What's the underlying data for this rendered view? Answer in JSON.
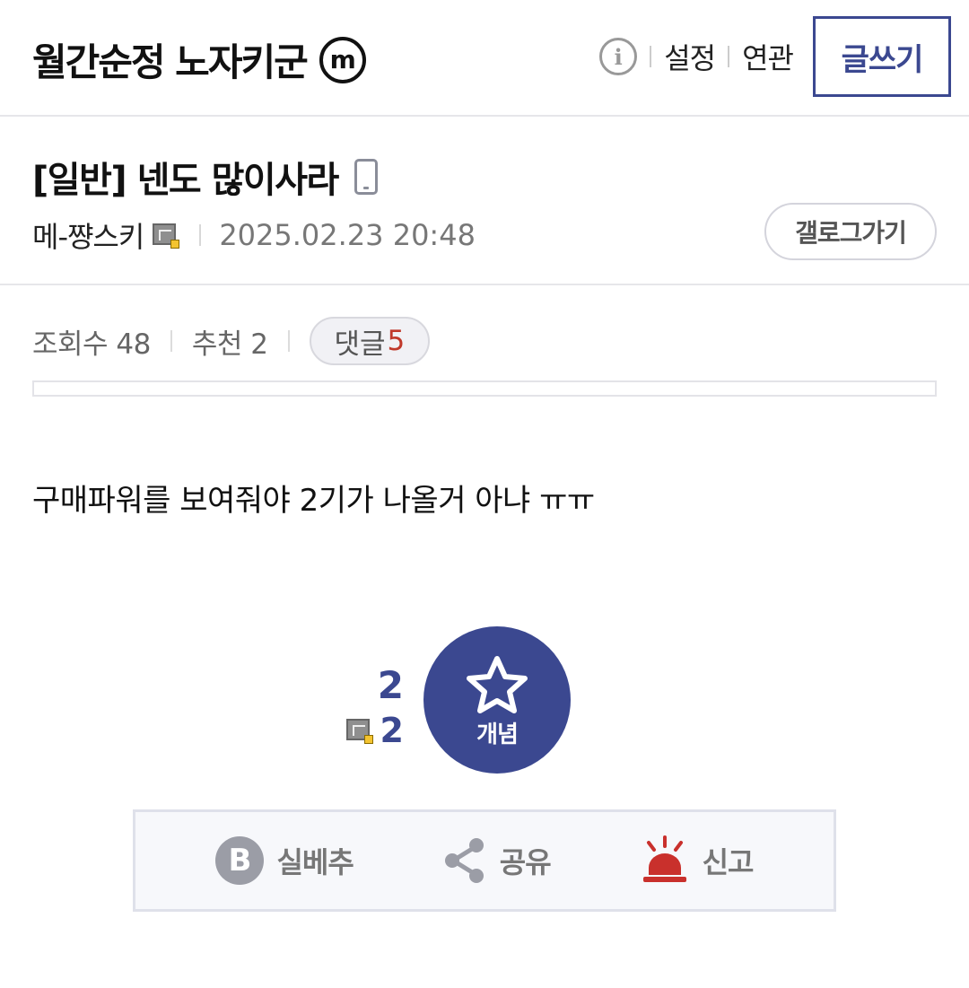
{
  "header": {
    "gallery_title": "월간순정 노자키군",
    "badge": "m",
    "settings_label": "설정",
    "related_label": "연관",
    "write_label": "글쓰기"
  },
  "post": {
    "title": "[일반] 넨도 많이사라",
    "author": "메-쨩스키",
    "date": "2025.02.23 20:48",
    "gallog_button": "갤로그가기",
    "body": "구매파워를 보여줘야 2기가 나올거 아냐 ㅠㅠ"
  },
  "stats": {
    "views": "조회수 48",
    "recommends": "추천 2",
    "comments_label": "댓글",
    "comments_count": "5"
  },
  "recommend": {
    "total": "2",
    "fixed_count": "2",
    "button_label": "개념"
  },
  "actions": {
    "silbe_label": "실베추",
    "share_label": "공유",
    "report_label": "신고"
  },
  "colors": {
    "accent": "#3b4890",
    "comment_count": "#c0392b",
    "report": "#c9302c"
  }
}
